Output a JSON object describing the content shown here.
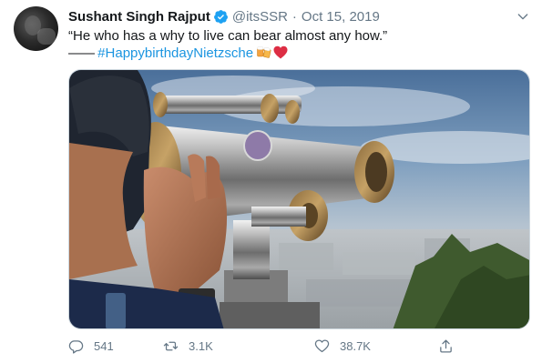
{
  "tweet": {
    "author_name": "Sushant Singh Rajput",
    "handle": "@itsSSR",
    "separator": "·",
    "date": "Oct 15, 2019",
    "text_line1": "“He who has a why to live can bear almost any how.”",
    "dash": "——",
    "hashtag": "#HappybirthdayNietzsche",
    "emojis": [
      "beer-mugs-emoji",
      "red-heart-emoji"
    ]
  },
  "actions": {
    "reply_count": "541",
    "retweet_count": "3.1K",
    "like_count": "38.7K"
  },
  "icons": {
    "verified": "verified-badge-icon",
    "more": "chevron-down-icon",
    "reply": "reply-icon",
    "retweet": "retweet-icon",
    "like": "heart-icon",
    "share": "share-icon"
  },
  "colors": {
    "link": "#1b95e0",
    "verified": "#1da1f2",
    "secondary_text": "#657786",
    "primary_text": "#14171a"
  }
}
